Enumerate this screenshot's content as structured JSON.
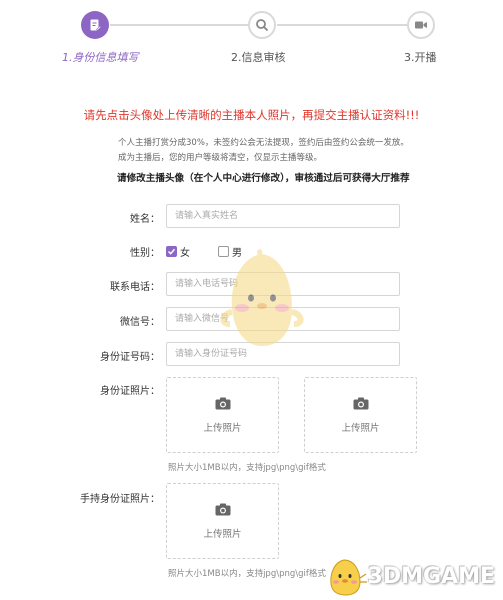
{
  "steps": [
    {
      "label": "1.身份信息填写",
      "icon": "edit-icon",
      "state": "active"
    },
    {
      "label": "2.信息审核",
      "icon": "search-icon",
      "state": "inactive"
    },
    {
      "label": "3.开播",
      "icon": "video-camera-icon",
      "state": "inactive"
    }
  ],
  "notice": "请先点击头像处上传清晰的主播本人照片，再提交主播认证资料!!!",
  "info_lines": [
    "个人主播打赏分成30%，未签约公会无法提现，签约后由签约公会统一发放。",
    "成为主播后，您的用户等级将清空，仅显示主播等级。"
  ],
  "avatar_notice": "请修改主播头像（在个人中心进行修改），审核通过后可获得大厅推荐",
  "form": {
    "name": {
      "label": "姓名：",
      "placeholder": "请输入真实姓名",
      "value": ""
    },
    "gender": {
      "label": "性别：",
      "options": [
        "女",
        "男"
      ],
      "selected": "女"
    },
    "phone": {
      "label": "联系电话：",
      "placeholder": "请输入电话号码",
      "value": ""
    },
    "wechat": {
      "label": "微信号：",
      "placeholder": "请输入微信号",
      "value": ""
    },
    "idnum": {
      "label": "身份证号码：",
      "placeholder": "请输入身份证号码",
      "value": ""
    },
    "idphoto": {
      "label": "身份证照片：",
      "upload_label": "上传照片",
      "hint": "照片大小1MB以内，支持jpg\\png\\gif格式"
    },
    "handheld": {
      "label": "手持身份证照片：",
      "upload_label": "上传照片",
      "hint": "照片大小1MB以内，支持jpg\\png\\gif格式"
    }
  },
  "watermark": "3DMGAME",
  "colors": {
    "accent": "#8d65c5",
    "notice": "#e0352b"
  }
}
